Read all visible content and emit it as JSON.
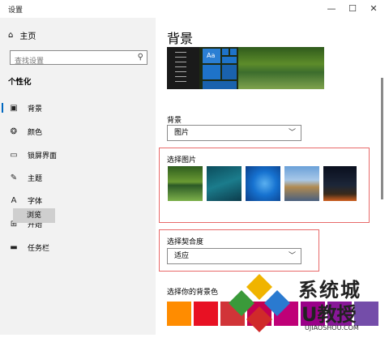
{
  "window": {
    "title": "设置",
    "controls": {
      "minimize": "—",
      "maximize": "☐",
      "close": "✕"
    }
  },
  "sidebar": {
    "home_label": "主页",
    "search_placeholder": "查找设置",
    "section_title": "个性化",
    "items": [
      {
        "label": "背景",
        "icon": "picture-icon",
        "active": true
      },
      {
        "label": "颜色",
        "icon": "palette-icon",
        "active": false
      },
      {
        "label": "锁屏界面",
        "icon": "monitor-icon",
        "active": false
      },
      {
        "label": "主题",
        "icon": "theme-icon",
        "active": false
      },
      {
        "label": "字体",
        "icon": "font-icon",
        "active": false
      },
      {
        "label": "开始",
        "icon": "start-icon",
        "active": false
      },
      {
        "label": "任务栏",
        "icon": "taskbar-icon",
        "active": false
      }
    ]
  },
  "main": {
    "page_title": "背景",
    "preview_tile_text": "Aa",
    "background_label": "背景",
    "background_value": "图片",
    "choose_picture_label": "选择图片",
    "browse_label": "浏览",
    "fit_label": "选择契合度",
    "fit_value": "适应",
    "bg_color_label": "选择你的背景色"
  },
  "colors": {
    "accent": "#0067c0",
    "highlight_border": "#e86a6a",
    "swatches": [
      "#ff8c00",
      "#e81123",
      "#d13438",
      "#c30052",
      "#bf0077",
      "#9a0089",
      "#881798",
      "#744da9"
    ]
  },
  "watermark": {
    "text_cn": "系统城",
    "text_en": "U教授",
    "url": "UJIAOSHOU.COM"
  }
}
